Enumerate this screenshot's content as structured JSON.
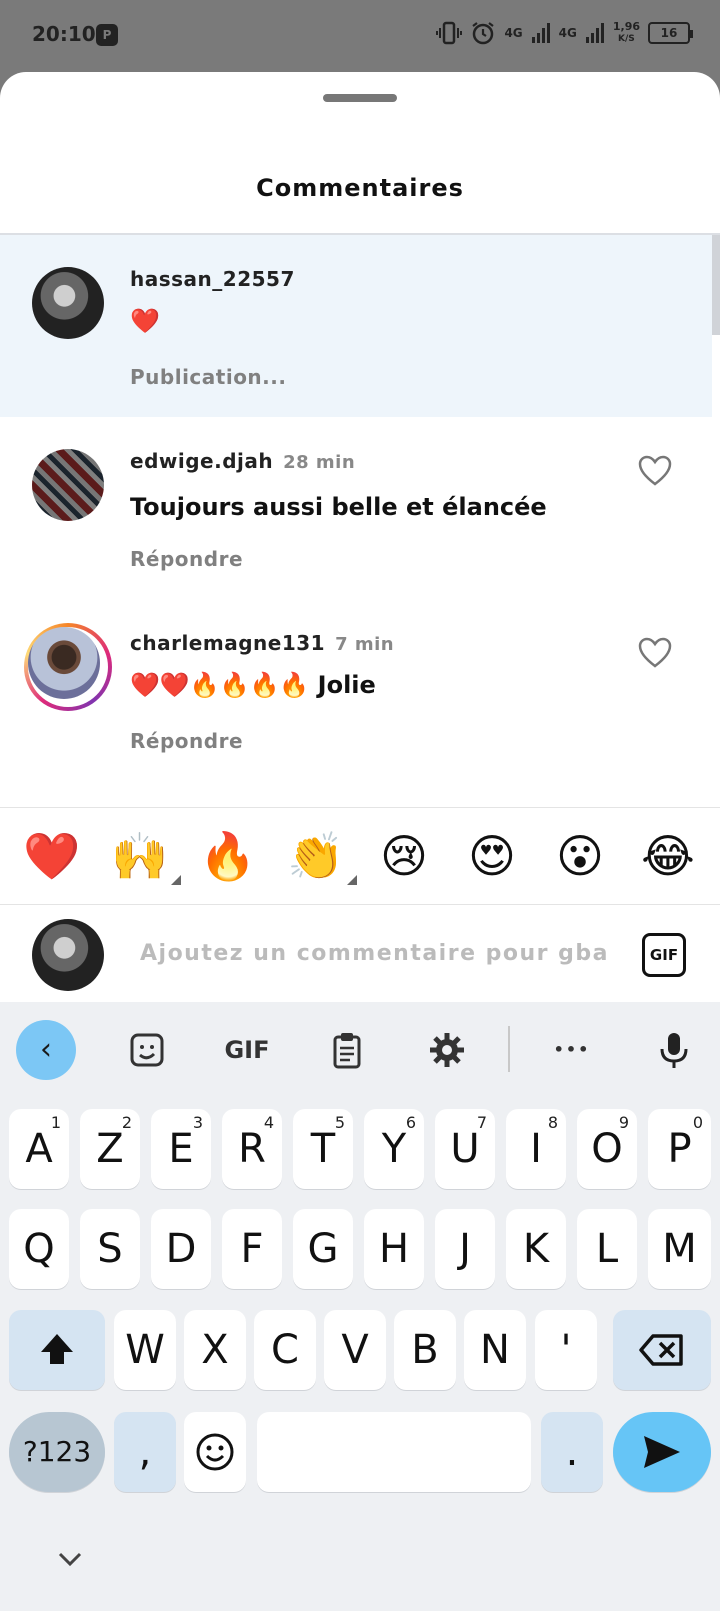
{
  "status_bar": {
    "time": "20:10",
    "app_icon": "P",
    "network1": "4G",
    "network2": "4G",
    "speed_value": "1,96",
    "speed_unit": "K/S",
    "battery": "16"
  },
  "sheet": {
    "title": "Commentaires"
  },
  "comments": [
    {
      "username": "hassan_22557",
      "time": "",
      "text": "❤️",
      "action": "Publication..."
    },
    {
      "username": "edwige.djah",
      "time": "28 min",
      "text": "Toujours aussi belle et élancée",
      "action": "Répondre"
    },
    {
      "username": "charlemagne131",
      "time": "7 min",
      "text": "❤️❤️🔥🔥🔥🔥 Jolie",
      "action": "Répondre"
    }
  ],
  "emoji_bar": [
    "❤️",
    "🙌",
    "🔥",
    "👏",
    "😢",
    "😍",
    "😮",
    "😂"
  ],
  "composer": {
    "placeholder": "Ajoutez un commentaire pour gbane",
    "gif_label": "GIF"
  },
  "keyboard": {
    "toolbar": {
      "back": "‹",
      "gif": "GIF",
      "more": "•••"
    },
    "row1": [
      {
        "k": "A",
        "n": "1"
      },
      {
        "k": "Z",
        "n": "2"
      },
      {
        "k": "E",
        "n": "3"
      },
      {
        "k": "R",
        "n": "4"
      },
      {
        "k": "T",
        "n": "5"
      },
      {
        "k": "Y",
        "n": "6"
      },
      {
        "k": "U",
        "n": "7"
      },
      {
        "k": "I",
        "n": "8"
      },
      {
        "k": "O",
        "n": "9"
      },
      {
        "k": "P",
        "n": "0"
      }
    ],
    "row2": [
      "Q",
      "S",
      "D",
      "F",
      "G",
      "H",
      "J",
      "K",
      "L",
      "M"
    ],
    "row3": [
      "W",
      "X",
      "C",
      "V",
      "B",
      "N",
      "'"
    ],
    "sym_label": "?123",
    "comma": ",",
    "period": ".",
    "colors": {
      "accent": "#66c5f6",
      "function_key": "#d5e4f2",
      "symbol_key": "#b7c6d2",
      "background": "#eef0f3"
    }
  }
}
